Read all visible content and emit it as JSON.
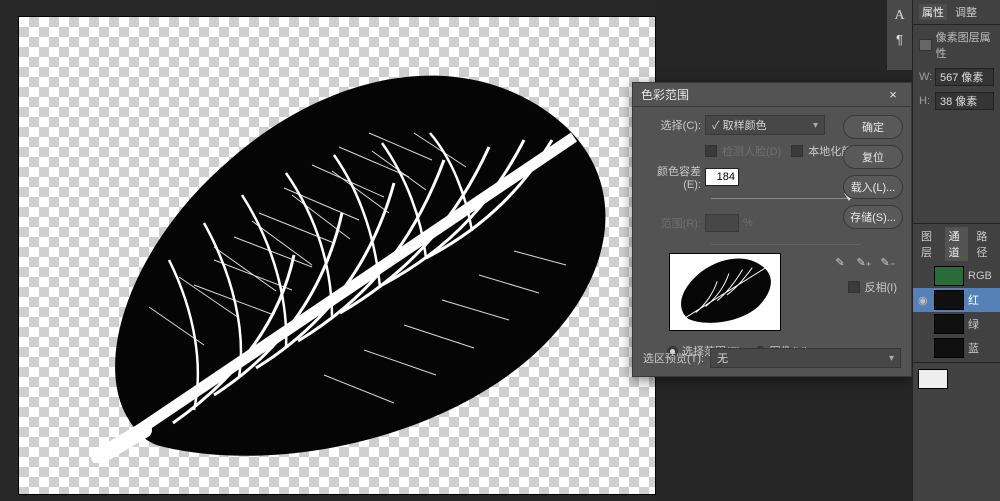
{
  "dialog": {
    "title": "色彩范围",
    "select_label": "选择(C):",
    "select_value": "✓ 取样颜色",
    "detect_faces_label": "检测人脸(D)",
    "localized_clusters_label": "本地化颜色簇(Z)",
    "fuzziness_label": "颜色容差(E):",
    "fuzziness_value": "184",
    "range_label": "范围(R):",
    "range_value": "",
    "range_unit": "%",
    "radio_selection": "选择范围(E)",
    "radio_image": "图像(M)",
    "invert_label": "反相(I)",
    "preview_label": "选区预览(T):",
    "preview_value": "无",
    "buttons": {
      "ok": "确定",
      "reset": "复位",
      "load": "载入(L)...",
      "save": "存储(S)..."
    }
  },
  "right_panel": {
    "tabs_top": {
      "properties": "属性",
      "adjustments": "调整"
    },
    "props_title": "像素图层属性",
    "width_label": "W:",
    "width_value": "567 像素",
    "height_label": "H:",
    "height_value": "38 像素",
    "mid_tabs": {
      "layers": "图层",
      "channels": "通道",
      "paths": "路径"
    },
    "channels": [
      {
        "name": "RGB"
      },
      {
        "name": "红"
      },
      {
        "name": "绿"
      },
      {
        "name": "蓝"
      }
    ]
  },
  "tool_icons": {
    "text": "A",
    "paragraph": "¶"
  }
}
